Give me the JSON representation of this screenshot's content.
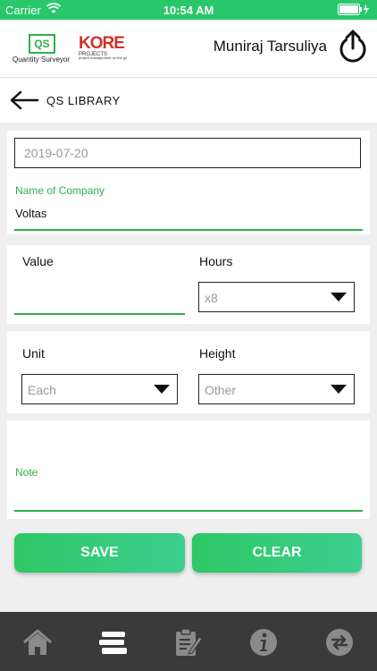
{
  "status_bar": {
    "carrier": "Carrier",
    "time": "10:54 AM"
  },
  "header": {
    "qs_logo_text": "QS",
    "qs_logo_caption": "Quantity Surveyor",
    "kore_logo_text": "KORE",
    "kore_logo_sub": "PROJECTS",
    "kore_logo_tagline": "project management on the go",
    "user_name": "Muniraj Tarsuliya",
    "logout_icon": "power-icon"
  },
  "nav": {
    "back_icon": "back-arrow-icon",
    "title": "QS LIBRARY"
  },
  "form": {
    "date_value": "2019-07-20",
    "company_label": "Name of Company",
    "company_value": "Voltas",
    "value_label": "Value",
    "value_value": "",
    "hours_label": "Hours",
    "hours_value": "x8",
    "unit_label": "Unit",
    "unit_value": "Each",
    "height_label": "Height",
    "height_value": "Other",
    "note_label": "Note",
    "note_value": ""
  },
  "buttons": {
    "save_label": "SAVE",
    "clear_label": "CLEAR"
  },
  "tabbar": {
    "items": [
      "home-icon",
      "library-books-icon",
      "checklist-icon",
      "info-icon",
      "sync-icon"
    ]
  },
  "colors": {
    "accent": "#2eb04d",
    "status_bar": "#28c76a",
    "tabbar": "#3a3a3a",
    "brand_red": "#d0322b"
  }
}
